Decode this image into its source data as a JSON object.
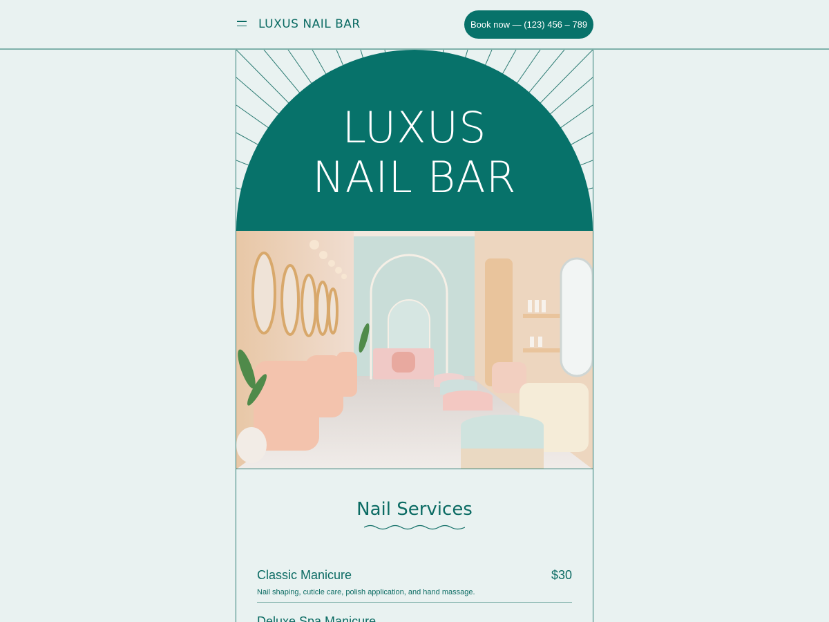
{
  "header": {
    "brand": "LUXUS NAIL BAR",
    "book_label": "Book now — (123) 456 – 789"
  },
  "hero": {
    "line1": "LUXUS",
    "line2": "NAIL BAR"
  },
  "services": {
    "title": "Nail Services",
    "items": [
      {
        "name": "Classic Manicure",
        "price": "$30",
        "description": "Nail shaping, cuticle care, polish application, and hand massage."
      },
      {
        "name": "Deluxe Spa Manicure",
        "price": "",
        "description": ""
      }
    ]
  },
  "colors": {
    "background": "#e9f2f1",
    "brand_green": "#07726a",
    "text_green": "#0b6b63",
    "line": "#7fb1aa"
  },
  "icons": {
    "menu": "hamburger-icon"
  }
}
